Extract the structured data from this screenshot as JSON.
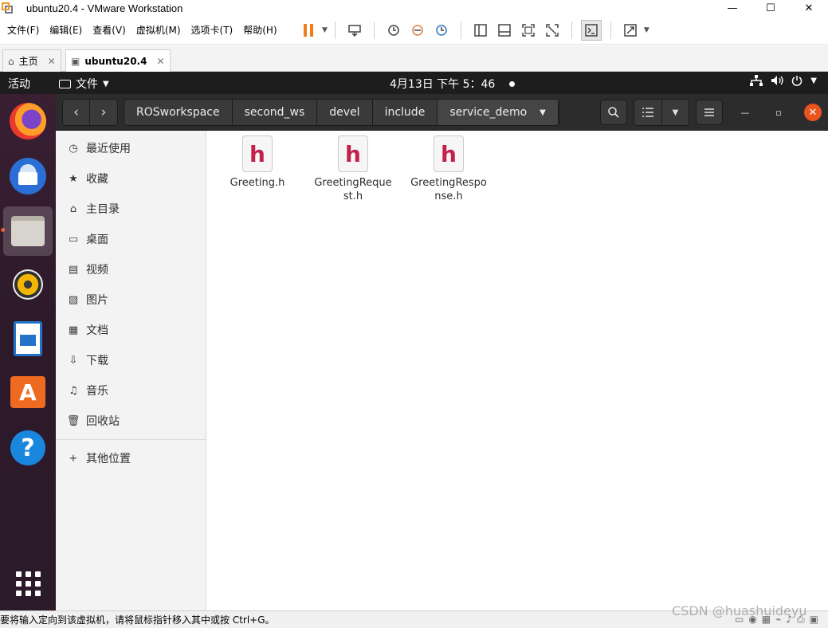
{
  "vm": {
    "window_title": "ubuntu20.4 - VMware Workstation",
    "window_controls": {
      "minimize": "—",
      "maximize": "☐",
      "close": "✕"
    },
    "menu": [
      "文件(F)",
      "编辑(E)",
      "查看(V)",
      "虚拟机(M)",
      "选项卡(T)",
      "帮助(H)"
    ],
    "tabs": [
      {
        "label": "主页",
        "icon": "home-icon",
        "active": false
      },
      {
        "label": "ubuntu20.4",
        "icon": "vm-icon",
        "active": true
      }
    ],
    "status_message": "要将输入定向到该虚拟机，请将鼠标指针移入其中或按 Ctrl+G。"
  },
  "gnome": {
    "activities": "活动",
    "app_menu": "文件",
    "clock": "4月13日  下午 5：46"
  },
  "dock": {
    "apps": [
      {
        "name": "firefox",
        "icon": "firefox-icon",
        "running": false
      },
      {
        "name": "thunderbird",
        "icon": "thunderbird-icon",
        "running": false
      },
      {
        "name": "files",
        "icon": "files-icon",
        "running": true
      },
      {
        "name": "rhythmbox",
        "icon": "rhythmbox-icon",
        "running": false
      },
      {
        "name": "libreoffice-writer",
        "icon": "writer-icon",
        "running": false
      },
      {
        "name": "ubuntu-software",
        "icon": "software-icon",
        "glyph": "A",
        "running": false
      },
      {
        "name": "help",
        "icon": "help-icon",
        "glyph": "?",
        "running": false
      }
    ]
  },
  "nautilus": {
    "breadcrumbs": [
      "ROSworkspace",
      "second_ws",
      "devel",
      "include",
      "service_demo"
    ],
    "sidebar": [
      {
        "label": "最近使用",
        "icon": "recent-icon"
      },
      {
        "label": "收藏",
        "icon": "star-icon"
      },
      {
        "label": "主目录",
        "icon": "home-icon"
      },
      {
        "label": "桌面",
        "icon": "desktop-icon"
      },
      {
        "label": "视频",
        "icon": "video-icon"
      },
      {
        "label": "图片",
        "icon": "picture-icon"
      },
      {
        "label": "文档",
        "icon": "document-icon"
      },
      {
        "label": "下载",
        "icon": "download-icon"
      },
      {
        "label": "音乐",
        "icon": "music-icon"
      },
      {
        "label": "回收站",
        "icon": "trash-icon"
      },
      {
        "label": "其他位置",
        "icon": "plus-icon"
      }
    ],
    "files": [
      {
        "name": "Greeting.h",
        "icon_glyph": "h"
      },
      {
        "name": "GreetingRequest.h",
        "icon_glyph": "h"
      },
      {
        "name": "GreetingResponse.h",
        "icon_glyph": "h"
      }
    ]
  },
  "watermark": "CSDN @huashuideyu",
  "colors": {
    "ubuntu_orange": "#e9541f",
    "header_dark": "#2c2c2c",
    "file_glyph": "#c2224a",
    "pause_orange": "#f07c1c"
  }
}
